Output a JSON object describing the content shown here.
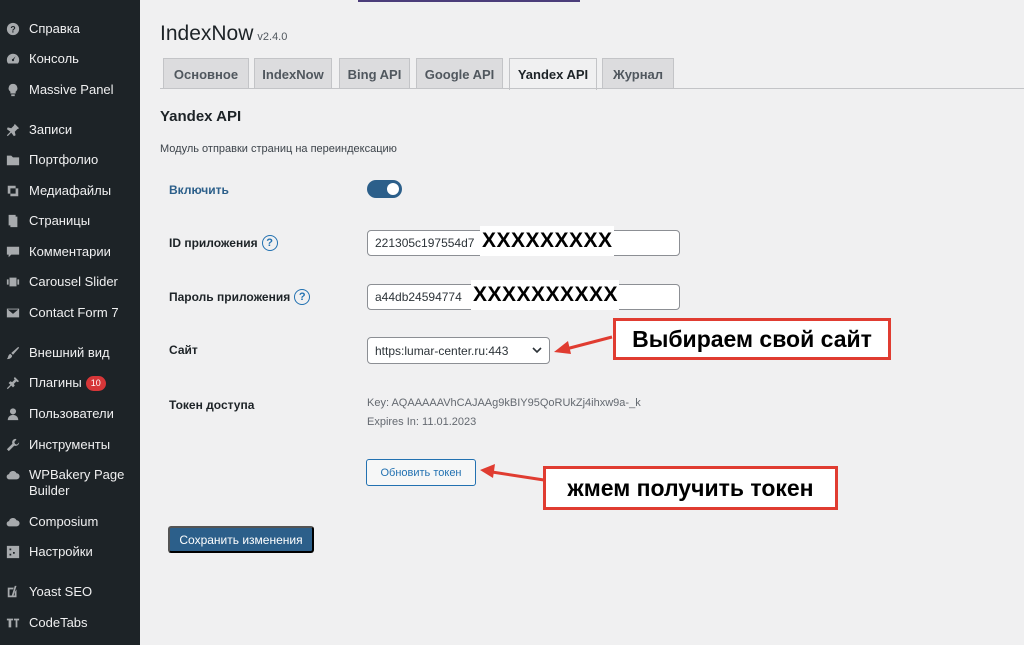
{
  "sidebar": {
    "items": [
      {
        "label": "Справка",
        "icon": "help-icon"
      },
      {
        "label": "Консоль",
        "icon": "dashboard-icon"
      },
      {
        "label": "Massive Panel",
        "icon": "lightbulb-icon"
      },
      {
        "label": "Записи",
        "icon": "pin-icon"
      },
      {
        "label": "Портфолио",
        "icon": "folder-icon"
      },
      {
        "label": "Медиафайлы",
        "icon": "media-icon"
      },
      {
        "label": "Страницы",
        "icon": "pages-icon"
      },
      {
        "label": "Комментарии",
        "icon": "comment-icon"
      },
      {
        "label": "Carousel Slider",
        "icon": "slider-icon"
      },
      {
        "label": "Contact Form 7",
        "icon": "mail-icon"
      },
      {
        "label": "Внешний вид",
        "icon": "brush-icon"
      },
      {
        "label": "Плагины",
        "icon": "plugin-icon",
        "badge": "10"
      },
      {
        "label": "Пользователи",
        "icon": "user-icon"
      },
      {
        "label": "Инструменты",
        "icon": "wrench-icon"
      },
      {
        "label": "WPBakery Page Builder",
        "icon": "cloud-icon"
      },
      {
        "label": "Composium",
        "icon": "cloud-icon"
      },
      {
        "label": "Настройки",
        "icon": "settings-icon"
      },
      {
        "label": "Yoast SEO",
        "icon": "yoast-icon"
      },
      {
        "label": "CodeTabs",
        "icon": "codetabs-icon"
      }
    ]
  },
  "page": {
    "title": "IndexNow",
    "version": "v2.4.0"
  },
  "tabs": [
    {
      "label": "Основное",
      "active": false
    },
    {
      "label": "IndexNow",
      "active": false
    },
    {
      "label": "Bing API",
      "active": false
    },
    {
      "label": "Google API",
      "active": false
    },
    {
      "label": "Yandex API",
      "active": true
    },
    {
      "label": "Журнал",
      "active": false
    }
  ],
  "section": {
    "title": "Yandex API",
    "description": "Модуль отправки страниц на переиндексацию"
  },
  "form": {
    "enable_label": "Включить",
    "enable_value": true,
    "app_id_label": "ID приложения",
    "app_id_value": "221305c197554d7",
    "app_id_mask": "XXXXXXXXX",
    "app_password_label": "Пароль приложения",
    "app_password_value": "a44db24594774",
    "app_password_mask": "XXXXXXXXXX",
    "site_label": "Сайт",
    "site_value": "https:lumar-center.ru:443",
    "token_label": "Токен доступа",
    "token_key": "Key: AQAAAAAVhCAJAAg9kBIY95QoRUkZj4ihxw9a-_k",
    "token_expires": "Expires In: 11.01.2023",
    "refresh_token_button": "Обновить токен",
    "save_button": "Сохранить изменения",
    "help_glyph": "?"
  },
  "annotations": {
    "choose_site": "Выбираем свой сайт",
    "get_token": "жмем получить токен",
    "color": "#e03c31"
  },
  "colors": {
    "sidebar_bg": "#1d2327",
    "accent": "#2c5f8a",
    "badge": "#d63638"
  }
}
